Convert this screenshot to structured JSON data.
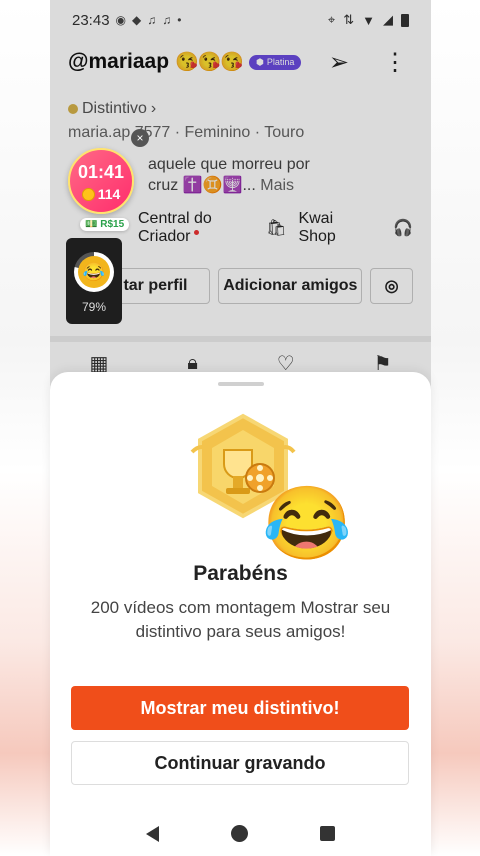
{
  "status_bar": {
    "time": "23:43",
    "icons": [
      "whatsapp-icon",
      "message-icon",
      "notification-icon",
      "dot"
    ],
    "right_icons": [
      "location-icon",
      "data-icon",
      "wifi-icon",
      "battery-icon"
    ]
  },
  "profile": {
    "handle": "@mariaap",
    "emojis": "😘😘😘",
    "badge_label": "Platina",
    "distintivo_label": "Distintivo",
    "meta": "maria.ap 7577 · Feminino · Touro",
    "bio_line1": "aquele que morreu por",
    "bio_line2": "cruz ✝️♊🕎...",
    "bio_more": "Mais",
    "creator_link": "Central do Criador",
    "shop_link": "Kwai Shop",
    "edit_button": "tar perfil",
    "add_friends_button": "Adicionar amigos"
  },
  "widgets": {
    "timer": "01:41",
    "coins": "114",
    "close": "×",
    "money": "R$15",
    "progress_label": "79%",
    "progress_value": 0.79
  },
  "sheet": {
    "title": "Parabéns",
    "description": "200 vídeos com montagem Mostrar seu distintivo para seus amigos!",
    "primary_button": "Mostrar meu distintivo!",
    "secondary_button": "Continuar gravando",
    "emoji": "😂"
  },
  "colors": {
    "accent": "#f04e1a",
    "badge": "#6a4be0"
  }
}
